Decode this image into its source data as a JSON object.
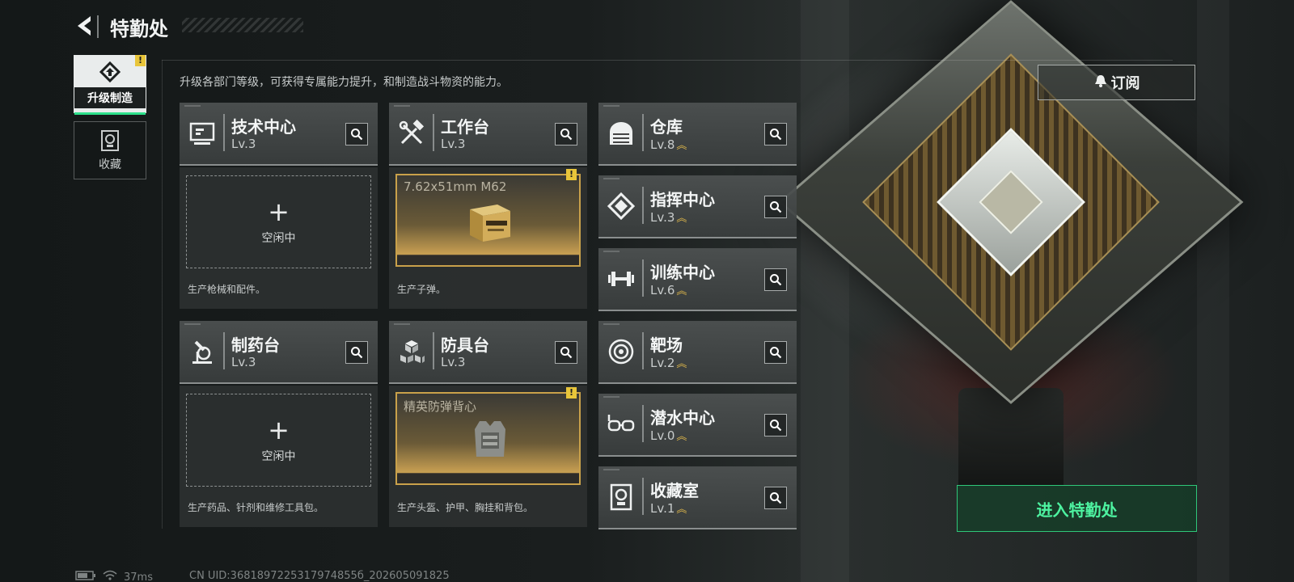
{
  "header": {
    "title": "特勤处"
  },
  "tabs": [
    {
      "label": "升级制造",
      "active": true,
      "icon": "upgrade-icon",
      "alert": "!"
    },
    {
      "label": "收藏",
      "active": false,
      "icon": "collection-icon"
    }
  ],
  "description": "升级各部门等级，可获得专属能力提升，和制造战斗物资的能力。",
  "production": [
    {
      "name": "技术中心",
      "level": "Lv.3",
      "icon": "monitor-icon",
      "slot_state": "空闲中",
      "plus": "+",
      "desc": "生产枪械和配件。"
    },
    {
      "name": "工作台",
      "level": "Lv.3",
      "icon": "tools-icon",
      "item": "7.62x51mm M62",
      "item_icon": "ammo-box-icon",
      "alert": "!",
      "desc": "生产子弹。"
    },
    {
      "name": "制药台",
      "level": "Lv.3",
      "icon": "microscope-icon",
      "slot_state": "空闲中",
      "plus": "+",
      "desc": "生产药品、针剂和维修工具包。"
    },
    {
      "name": "防具台",
      "level": "Lv.3",
      "icon": "armor-boxes-icon",
      "item": "精英防弹背心",
      "item_icon": "vest-icon",
      "alert": "!",
      "desc": "生产头盔、护甲、胸挂和背包。"
    }
  ],
  "departments": [
    {
      "name": "仓库",
      "level": "Lv.8",
      "upgradable": true,
      "icon": "warehouse-icon"
    },
    {
      "name": "指挥中心",
      "level": "Lv.3",
      "upgradable": true,
      "icon": "command-icon"
    },
    {
      "name": "训练中心",
      "level": "Lv.6",
      "upgradable": true,
      "icon": "dumbbell-icon"
    },
    {
      "name": "靶场",
      "level": "Lv.2",
      "upgradable": true,
      "icon": "target-icon"
    },
    {
      "name": "潜水中心",
      "level": "Lv.0",
      "upgradable": true,
      "icon": "diving-mask-icon"
    },
    {
      "name": "收藏室",
      "level": "Lv.1",
      "upgradable": true,
      "icon": "collection-room-icon"
    }
  ],
  "upgrade_glyph": "︽",
  "subscribe_label": "订阅",
  "enter_label": "进入特勤处",
  "status": {
    "ping": "37ms",
    "uid": "CN UID:3681897225317974855б_202605091825"
  },
  "colors": {
    "accent_green": "#2de08a",
    "gold": "#c9a14a",
    "alert_yellow": "#e8c53a"
  }
}
